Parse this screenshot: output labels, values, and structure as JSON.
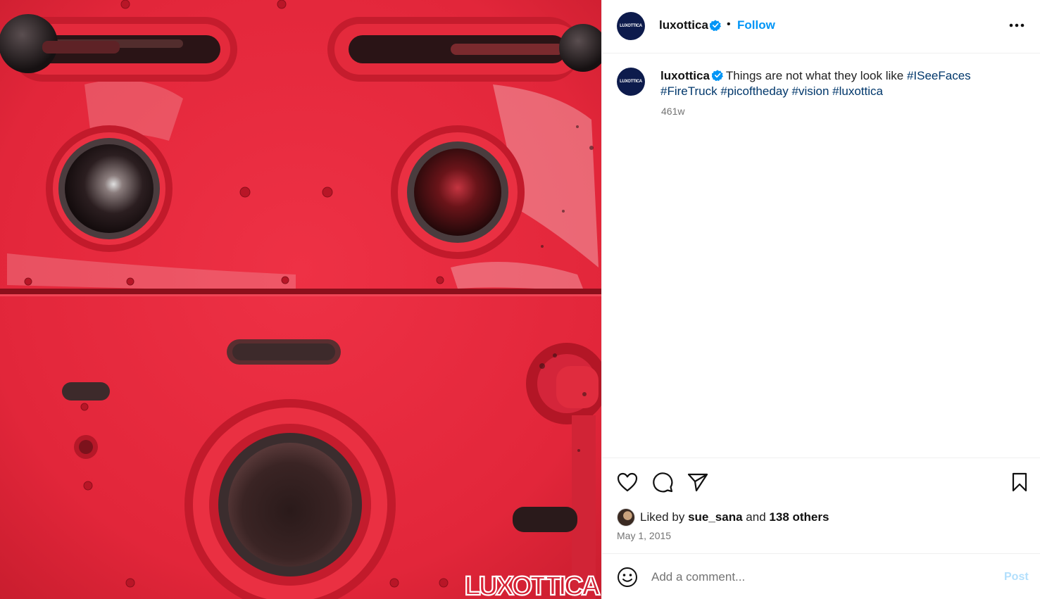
{
  "media": {
    "watermark": "LUXOTTICA",
    "colors": {
      "paint": "#e8283a",
      "paint_dark": "#b5141f",
      "metal": "#3a3536"
    }
  },
  "post": {
    "author": {
      "username": "luxottica",
      "avatar_text": "LUXOTTICA",
      "verified_icon": "verified-badge-icon",
      "verified_color": "#0095f6"
    },
    "follow_label": "Follow",
    "separator": "•",
    "more_icon": "more-options-icon",
    "caption": {
      "text": "Things are not what they look like",
      "hashtags": [
        "#ISeeFaces",
        "#FireTruck",
        "#picoftheday",
        "#vision",
        "#luxottica"
      ],
      "age": "461w"
    },
    "actions": {
      "like_icon": "heart-icon",
      "comment_icon": "comment-icon",
      "share_icon": "paper-plane-icon",
      "save_icon": "bookmark-icon"
    },
    "likes": {
      "prefix": "Liked by",
      "user": "sue_sana",
      "conjunction": "and",
      "others": "138 others"
    },
    "date": "May 1, 2015",
    "comment": {
      "placeholder": "Add a comment...",
      "post_label": "Post",
      "emoji_icon": "smiley-icon"
    }
  },
  "theme": {
    "link": "#0095f6",
    "hashtag": "#00376b",
    "muted": "#737373",
    "border": "#efefef",
    "post_disabled": "#b2dffc"
  }
}
